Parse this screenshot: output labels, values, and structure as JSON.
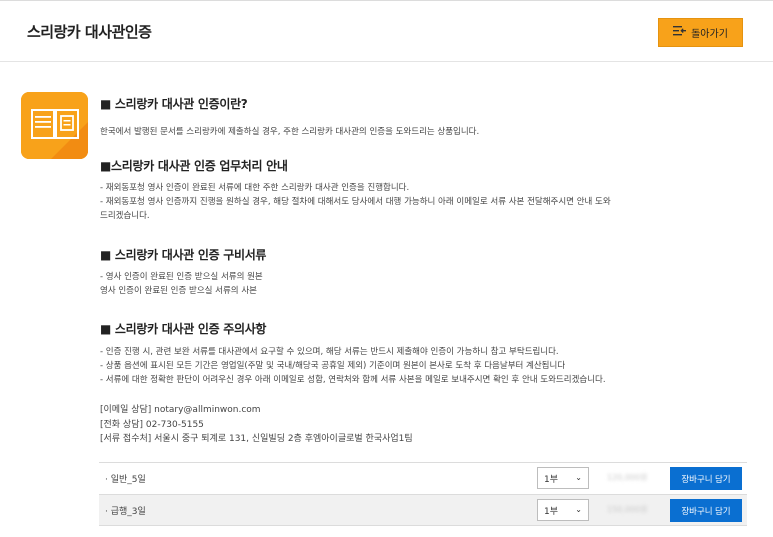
{
  "header": {
    "title": "스리랑카 대사관인증",
    "back_label": "돌아가기"
  },
  "sections": {
    "intro": {
      "heading": "■ 스리랑카 대사관 인증이란?",
      "lines": [
        "한국에서 발행된 문서를 스리랑카에 제출하실 경우, 주한 스리랑카 대사관의 인증을 도와드리는 상품입니다."
      ]
    },
    "process": {
      "heading": "■스리랑카 대사관 인증 업무처리 안내",
      "lines": [
        "- 재외동포청 영사 인증이 완료된 서류에 대한 주한 스리랑카 대사관 인증을 진행합니다.",
        "- 재외동포청 영사 인증까지 진행을 원하실 경우, 해당 절차에 대해서도 당사에서 대행 가능하니 아래 이메일로 서류 사본 전달해주시면 안내 도와",
        "드리겠습니다."
      ]
    },
    "documents": {
      "heading": "■ 스리랑카 대사관 인증 구비서류",
      "lines": [
        "- 영사 인증이 완료된 인증 받으실 서류의 원본",
        "영사 인증이 완료된 인증 받으실 서류의 사본"
      ]
    },
    "cautions": {
      "heading": "■ 스리랑카 대사관 인증 주의사항",
      "lines": [
        "- 인증 진행 시, 관련 보완 서류를 대사관에서 요구할 수 있으며, 해당 서류는 반드시 제출해야 인증이 가능하니 참고 부탁드립니다.",
        "- 상품 옵션에 표시된 모든 기간은 영업일(주말 및 국내/해당국 공휴일 제외) 기준이며 원본이 본사로 도착 후 다음날부터 계산됩니다",
        "- 서류에 대한 정확한 판단이 어려우신 경우 아래 이메일로 성함, 연락처와 함께 서류 사본을 메일로 보내주시면 확인 후 안내 도와드리겠습니다."
      ]
    },
    "contact": {
      "email": "[이메일 상담] notary@allminwon.com",
      "phone": "[전화 상담] 02-730-5155",
      "address": "[서류 접수처] 서울시 중구 퇴계로 131, 신일빌딩 2층 후엠아이글로벌 한국사업1팀"
    }
  },
  "options": [
    {
      "name": "· 일반_5일",
      "quantity": "1부",
      "price": "120,000원",
      "cart_label": "장바구니 담기"
    },
    {
      "name": "· 급행_3일",
      "quantity": "1부",
      "price": "150,000원",
      "cart_label": "장바구니 담기"
    }
  ],
  "colors": {
    "accent": "#f8a21a",
    "button_blue": "#0a6fd1"
  },
  "icons": {
    "back": "list-back-icon",
    "doc": "document-icon"
  }
}
